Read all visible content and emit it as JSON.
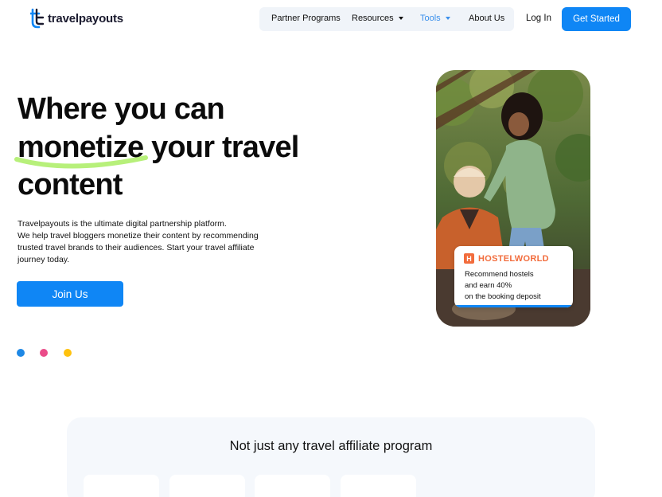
{
  "header": {
    "logo_text": "travelpayouts",
    "nav": [
      {
        "label": "Partner Programs"
      },
      {
        "label": "Resources"
      },
      {
        "label": "Tools"
      },
      {
        "label": "About Us"
      }
    ],
    "login_label": "Log In",
    "cta_label": "Get Started"
  },
  "hero": {
    "title_line1": "Where you can",
    "title_highlight": "monetize",
    "title_line2_rest": "your travel",
    "title_line3": "content",
    "desc_line1": "Travelpayouts is the ultimate digital partnership platform.",
    "desc_line2": "We help travel bloggers monetize their content by recommending trusted travel brands to their audiences. Start your travel affiliate journey today.",
    "join_label": "Join Us"
  },
  "promo": {
    "brand": "HOSTELWORLD",
    "brand_icon_letter": "H",
    "line1": "Recommend hostels",
    "line2": "and earn 40%",
    "line3": "on the booking deposit"
  },
  "dots": [
    "#1e88e5",
    "#ea4c89",
    "#ffc20e"
  ],
  "section": {
    "title": "Not just any travel affiliate program"
  },
  "colors": {
    "primary": "#0f86f5",
    "highlight": "#b7f07a",
    "hostelworld": "#f26c3c"
  }
}
